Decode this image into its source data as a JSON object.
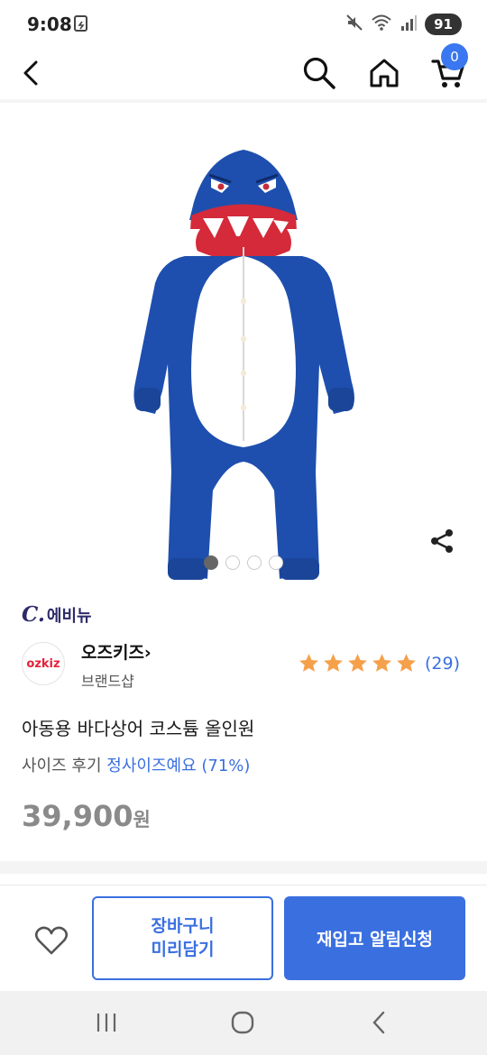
{
  "status_bar": {
    "time": "9:08",
    "battery": "91"
  },
  "top_nav": {
    "cart_count": "0"
  },
  "gallery": {
    "image_count": 4,
    "active_index": 0
  },
  "seller_label": {
    "c": "C.",
    "text": "에비뉴"
  },
  "brand": {
    "logo_text": "ozkiz",
    "name": "오즈키즈",
    "chevron": "›",
    "subtitle": "브랜드샵"
  },
  "rating": {
    "stars": 5,
    "count": "(29)",
    "star_color": "#f5a04a"
  },
  "product": {
    "title": "아동용 바다상어 코스튬 올인원",
    "size_review_label": "사이즈 후기",
    "size_review_value": "정사이즈예요 (71%)",
    "price": "39,900",
    "currency": "원"
  },
  "actions": {
    "cart_later_line1": "장바구니",
    "cart_later_line2": "미리담기",
    "restock_label": "재입고 알림신청"
  },
  "colors": {
    "accent": "#3a6fe0",
    "badge": "#3a77f0",
    "costume_blue": "#1e4fae"
  }
}
